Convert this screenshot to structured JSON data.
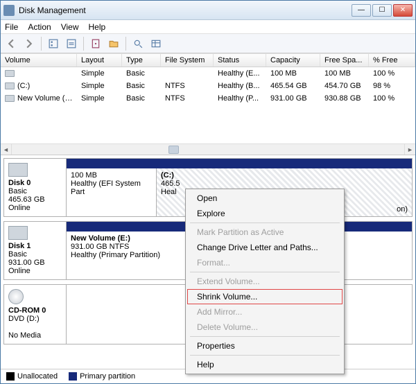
{
  "titlebar": {
    "title": "Disk Management"
  },
  "menubar": {
    "file": "File",
    "action": "Action",
    "view": "View",
    "help": "Help"
  },
  "columns": {
    "volume": "Volume",
    "layout": "Layout",
    "type": "Type",
    "fs": "File System",
    "status": "Status",
    "capacity": "Capacity",
    "freespace": "Free Spa...",
    "pctfree": "% Free"
  },
  "volumes": [
    {
      "name": "",
      "layout": "Simple",
      "type": "Basic",
      "fs": "",
      "status": "Healthy (E...",
      "capacity": "100 MB",
      "free": "100 MB",
      "pct": "100 %"
    },
    {
      "name": "(C:)",
      "layout": "Simple",
      "type": "Basic",
      "fs": "NTFS",
      "status": "Healthy (B...",
      "capacity": "465.54 GB",
      "free": "454.70 GB",
      "pct": "98 %"
    },
    {
      "name": "New Volume (E:)",
      "layout": "Simple",
      "type": "Basic",
      "fs": "NTFS",
      "status": "Healthy (P...",
      "capacity": "931.00 GB",
      "free": "930.88 GB",
      "pct": "100 %"
    }
  ],
  "disks": {
    "d0": {
      "label": "Disk 0",
      "type": "Basic",
      "size": "465.63 GB",
      "state": "Online",
      "p0": {
        "size": "100 MB",
        "desc": "Healthy (EFI System Part"
      },
      "p1": {
        "name": "(C:)",
        "line2": "465.5",
        "desc": "Heal",
        "tail": "on)"
      }
    },
    "d1": {
      "label": "Disk 1",
      "type": "Basic",
      "size": "931.00 GB",
      "state": "Online",
      "p0": {
        "name": "New Volume  (E:)",
        "line2": "931.00 GB NTFS",
        "desc": "Healthy (Primary Partition)"
      }
    },
    "cd": {
      "label": "CD-ROM 0",
      "sub": "DVD (D:)",
      "state": "No Media"
    }
  },
  "legend": {
    "unallocated": "Unallocated",
    "primary": "Primary partition"
  },
  "ctx": {
    "open": "Open",
    "explore": "Explore",
    "mark": "Mark Partition as Active",
    "change": "Change Drive Letter and Paths...",
    "format": "Format...",
    "extend": "Extend Volume...",
    "shrink": "Shrink Volume...",
    "mirror": "Add Mirror...",
    "delete": "Delete Volume...",
    "props": "Properties",
    "help": "Help"
  }
}
